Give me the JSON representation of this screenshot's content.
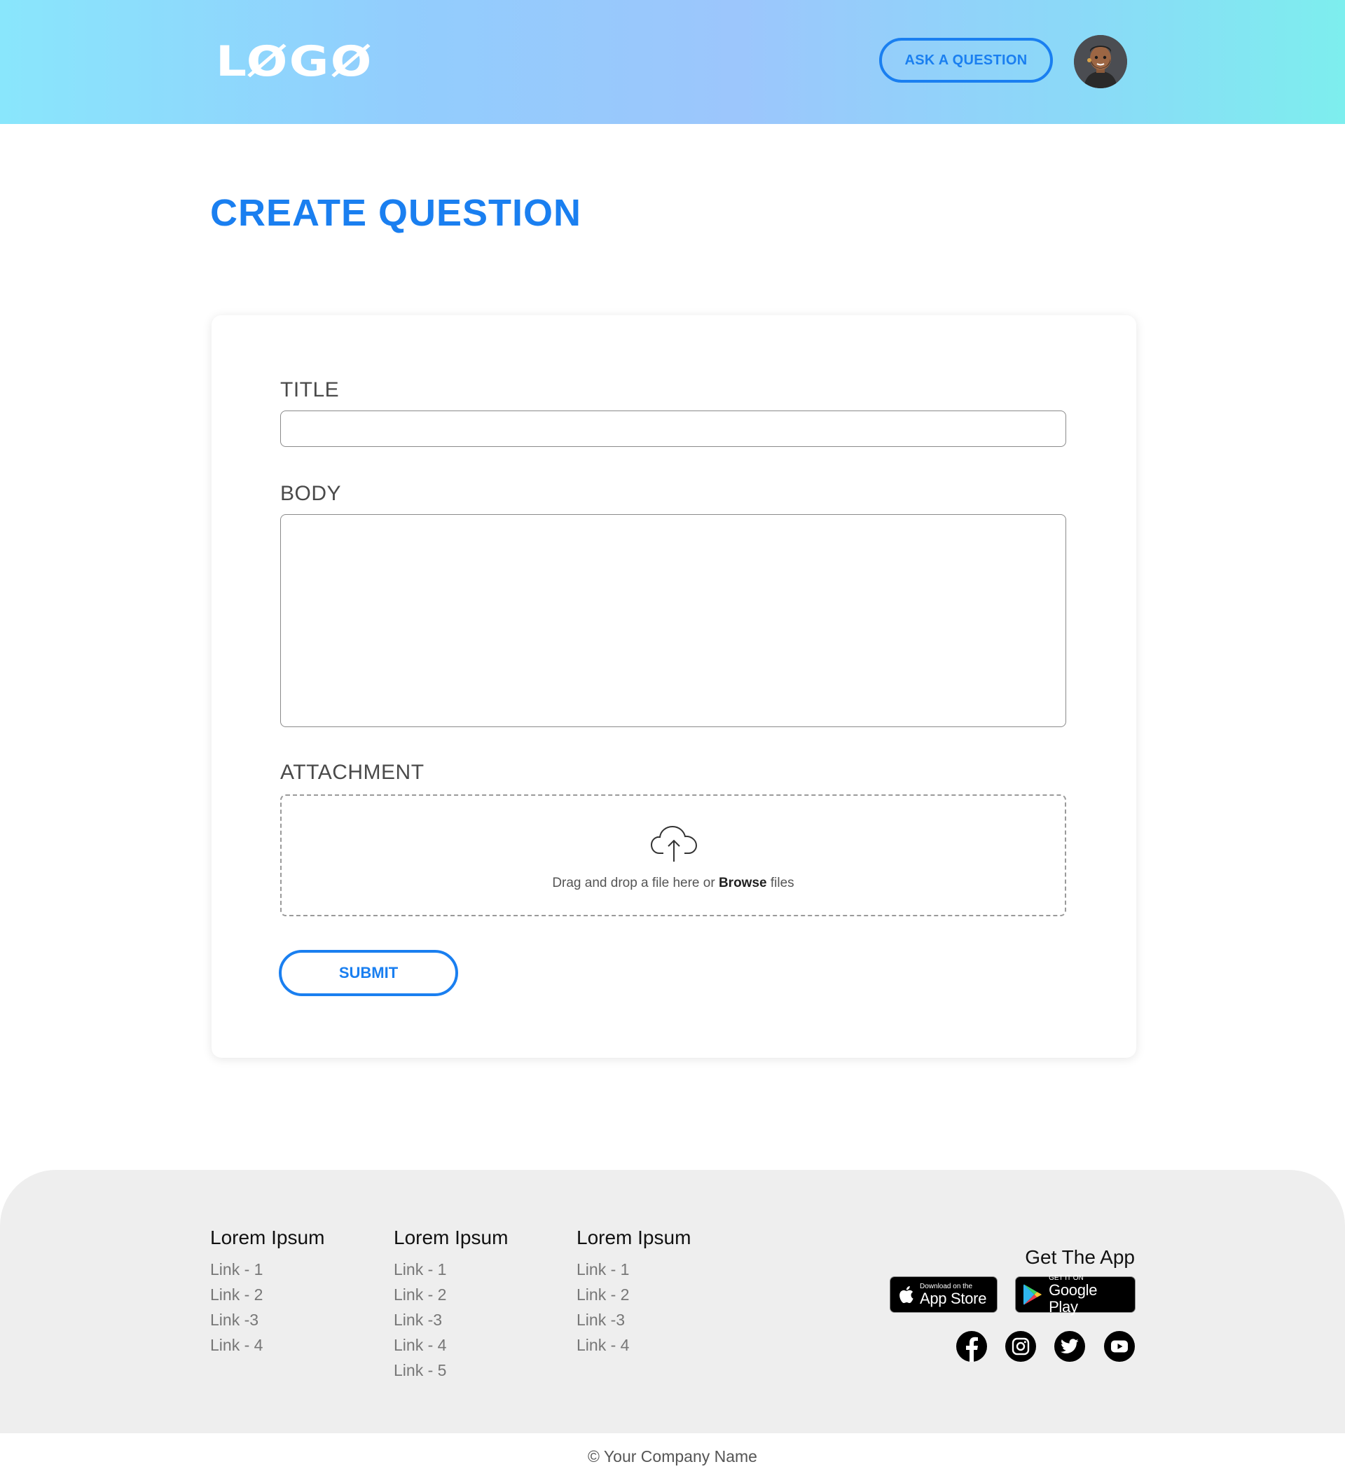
{
  "header": {
    "logo_text": "LØGØ",
    "ask_button_label": "ASK A QUESTION",
    "avatar_icon": "user-avatar-icon"
  },
  "page": {
    "title": "CREATE QUESTION"
  },
  "form": {
    "title_label": "TITLE",
    "title_value": "",
    "body_label": "BODY",
    "body_value": "",
    "attachment_label": "ATTACHMENT",
    "dropzone_icon": "cloud-upload-icon",
    "dropzone_text_before": "Drag and drop a file here or ",
    "dropzone_browse": "Browse",
    "dropzone_text_after": " files",
    "submit_label": "SUBMIT"
  },
  "footer": {
    "columns": [
      {
        "heading": "Lorem Ipsum",
        "links": [
          "Link - 1",
          "Link - 2",
          "Link -3",
          "Link - 4"
        ]
      },
      {
        "heading": "Lorem Ipsum",
        "links": [
          "Link - 1",
          "Link - 2",
          "Link -3",
          "Link - 4",
          "Link - 5"
        ]
      },
      {
        "heading": "Lorem Ipsum",
        "links": [
          "Link - 1",
          "Link - 2",
          "Link -3",
          "Link - 4"
        ]
      }
    ],
    "get_app_title": "Get The App",
    "app_store": {
      "small": "Download on the",
      "big": "App Store",
      "icon": "apple-icon"
    },
    "google_play": {
      "small": "GET IT ON",
      "big": "Google Play",
      "icon": "google-play-icon"
    },
    "social_icons": [
      "facebook-icon",
      "instagram-icon",
      "twitter-icon",
      "youtube-icon"
    ],
    "copyright": "© Your Company Name"
  },
  "colors": {
    "accent": "#1a7ff0",
    "header_gradient_start": "#89e6fc",
    "header_gradient_end": "#7deeee",
    "footer_bg": "#eeeeee"
  }
}
